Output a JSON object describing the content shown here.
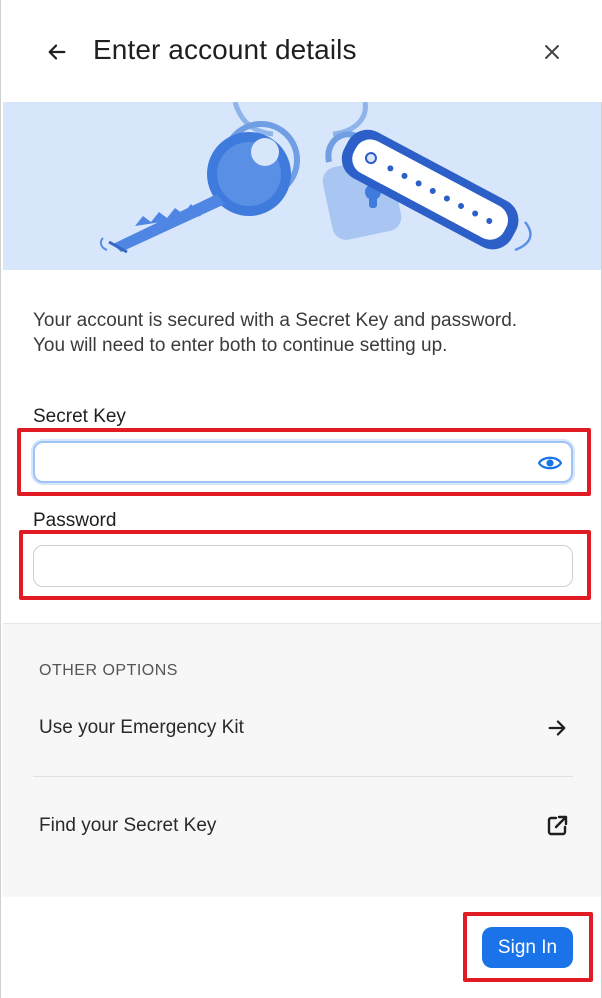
{
  "header": {
    "title": "Enter account details",
    "back_icon": "arrow-left-icon",
    "close_icon": "close-icon"
  },
  "intro": {
    "description": "Your account is secured with a Secret Key and password. You will need to enter both to continue setting up."
  },
  "form": {
    "secret_key": {
      "label": "Secret Key",
      "value": "",
      "placeholder": "",
      "icon": "eye-icon"
    },
    "password": {
      "label": "Password",
      "value": "",
      "placeholder": ""
    }
  },
  "other_options": {
    "heading": "OTHER OPTIONS",
    "items": [
      {
        "label": "Use your Emergency Kit",
        "icon": "arrow-right-icon"
      },
      {
        "label": "Find your Secret Key",
        "icon": "external-link-icon"
      }
    ]
  },
  "footer": {
    "signin_label": "Sign In"
  },
  "colors": {
    "accent": "#1a73e8",
    "banner_bg": "#d8e6fb",
    "highlight": "#e01b24"
  }
}
